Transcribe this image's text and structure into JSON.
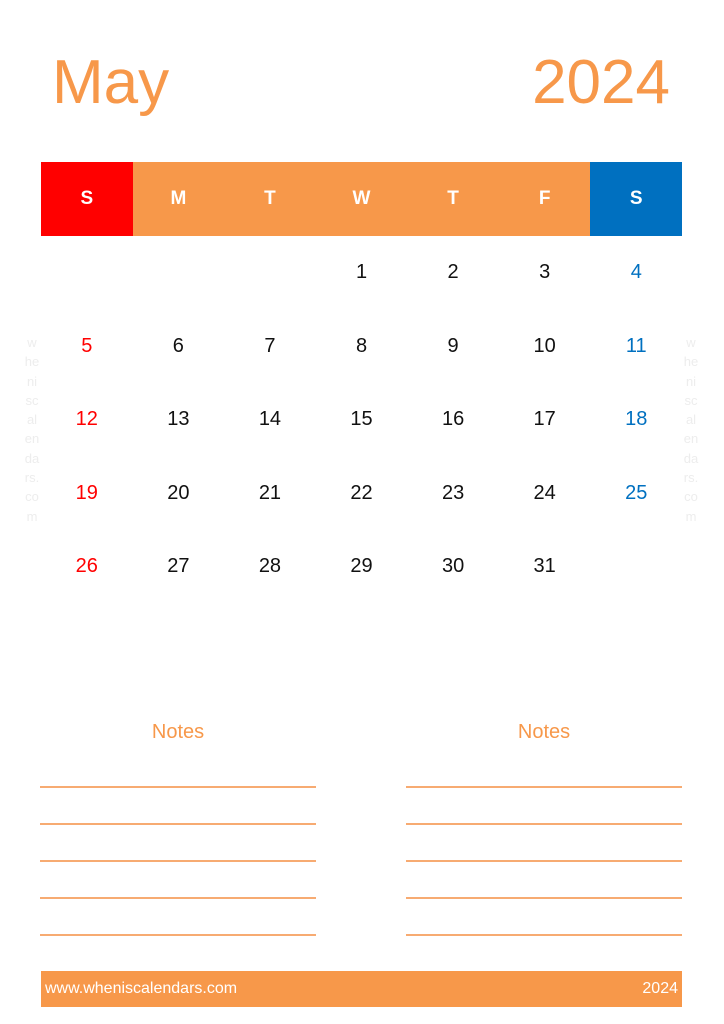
{
  "title": {
    "month": "May",
    "year": "2024"
  },
  "weekdays": [
    "S",
    "M",
    "T",
    "W",
    "T",
    "F",
    "S"
  ],
  "weeks": [
    [
      "",
      "",
      "",
      "1",
      "2",
      "3",
      "4"
    ],
    [
      "5",
      "6",
      "7",
      "8",
      "9",
      "10",
      "11"
    ],
    [
      "12",
      "13",
      "14",
      "15",
      "16",
      "17",
      "18"
    ],
    [
      "19",
      "20",
      "21",
      "22",
      "23",
      "24",
      "25"
    ],
    [
      "26",
      "27",
      "28",
      "29",
      "30",
      "31",
      ""
    ]
  ],
  "watermark": "wheniscalendars.com",
  "notes": {
    "left_title": "Notes",
    "right_title": "Notes",
    "line_count": 5
  },
  "footer": {
    "url": "www.wheniscalendars.com",
    "year": "2024"
  },
  "colors": {
    "accent": "#f7984a",
    "sunday": "#ff0000",
    "saturday": "#0070c0"
  }
}
